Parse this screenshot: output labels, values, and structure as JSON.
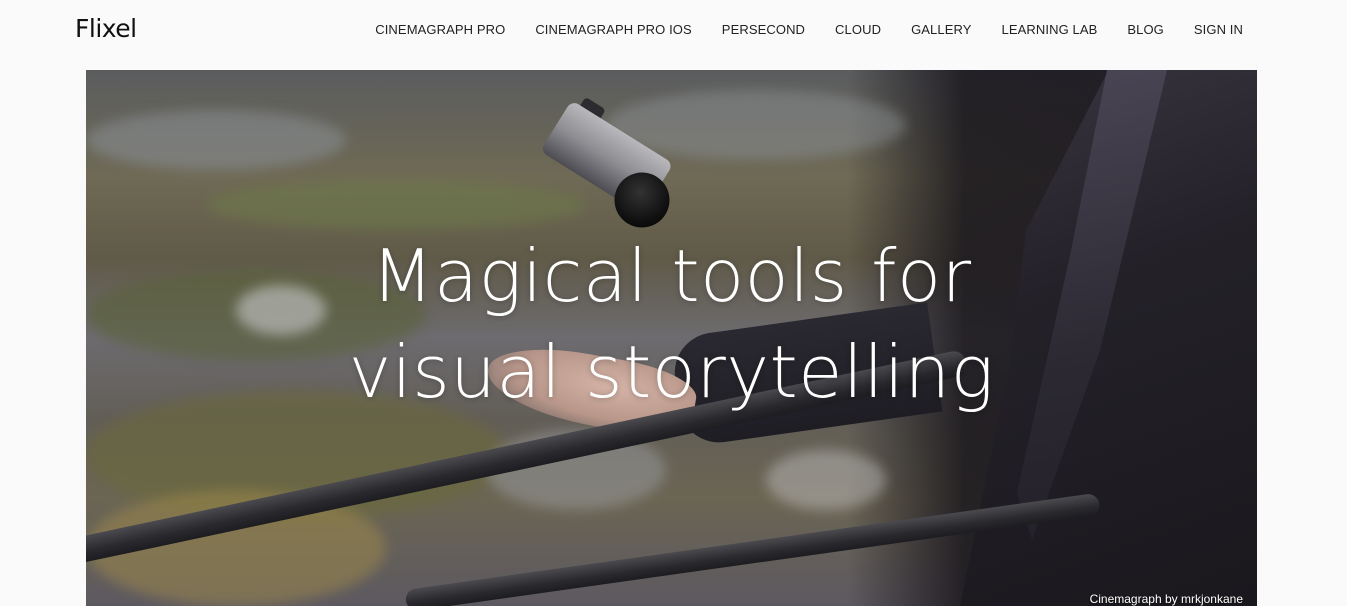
{
  "header": {
    "logo": "Flixel",
    "nav": [
      {
        "label": "CINEMAGRAPH PRO"
      },
      {
        "label": "CINEMAGRAPH PRO IOS"
      },
      {
        "label": "PERSECOND"
      },
      {
        "label": "CLOUD"
      },
      {
        "label": "GALLERY"
      },
      {
        "label": "LEARNING LAB"
      },
      {
        "label": "BLOG"
      },
      {
        "label": "SIGN IN"
      }
    ]
  },
  "hero": {
    "headline_line1": "Magical tools for",
    "headline_line2": "visual storytelling",
    "credit": "Cinemagraph by mrkjonkane"
  }
}
